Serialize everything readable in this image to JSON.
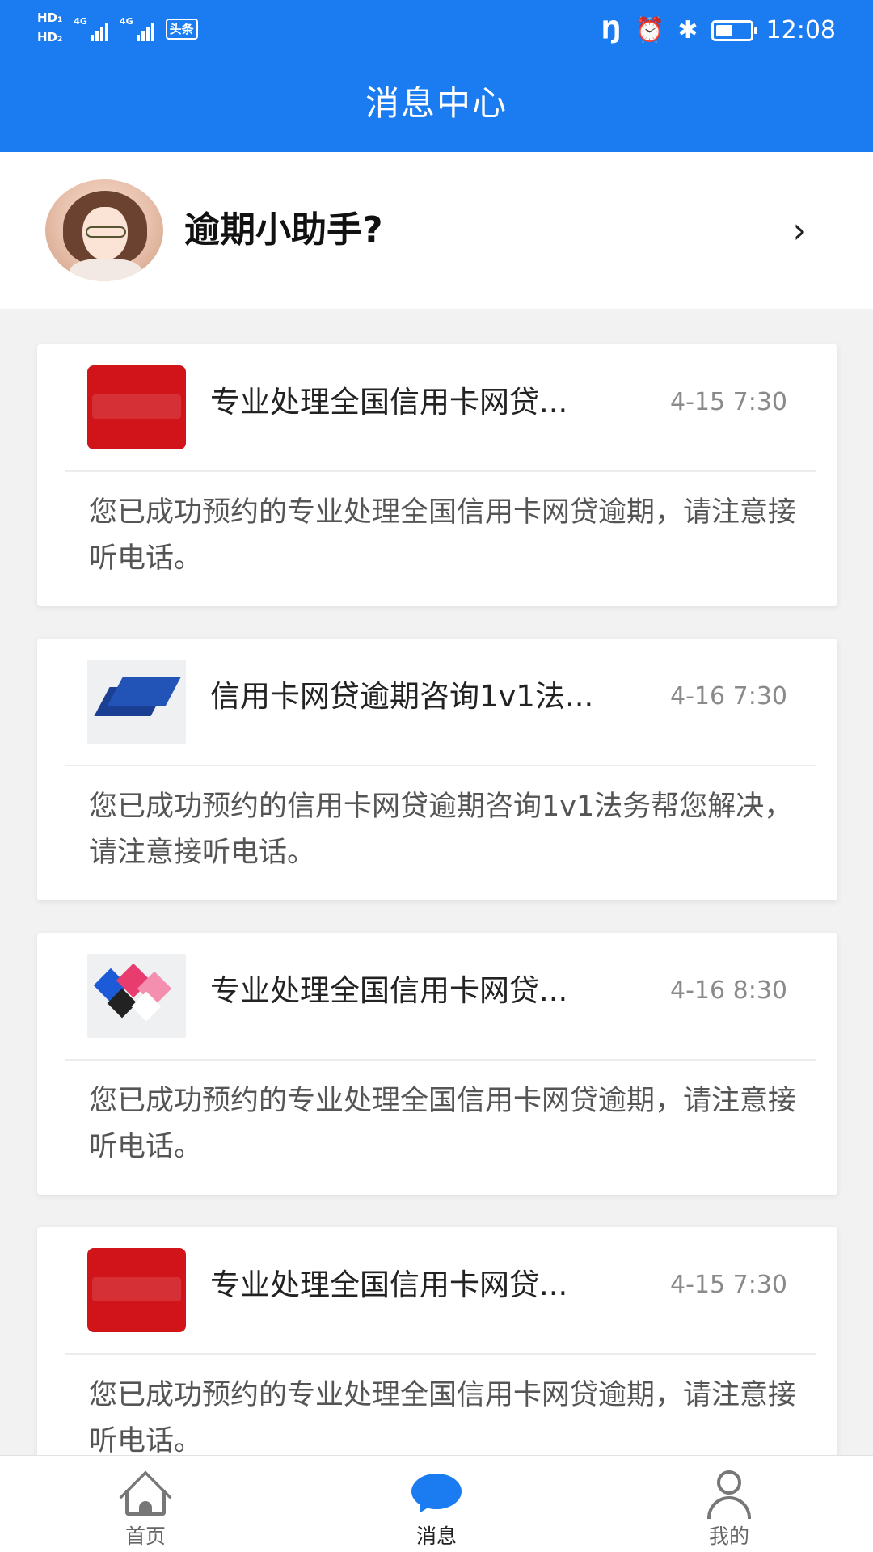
{
  "status_bar": {
    "hd1": "HD",
    "hd1_sub": "1",
    "hd2": "HD",
    "hd2_sub": "2",
    "net1": "4G",
    "net2": "4G",
    "app_badge": "头条",
    "time": "12:08",
    "icons": [
      "nfc-icon",
      "alarm-icon",
      "bluetooth-icon",
      "battery-icon"
    ]
  },
  "header": {
    "title": "消息中心"
  },
  "assistant": {
    "name": "逾期小助手?"
  },
  "messages": [
    {
      "thumb": "cny-red",
      "title": "专业处理全国信用卡网贷...",
      "time": "4-15 7:30",
      "body": "您已成功预约的专业处理全国信用卡网贷逾期，请注意接听电话。"
    },
    {
      "thumb": "blue-book",
      "title": "信用卡网贷逾期咨询1v1法...",
      "time": "4-16 7:30",
      "body": "您已成功预约的信用卡网贷逾期咨询1v1法务帮您解决，请注意接听电话。"
    },
    {
      "thumb": "color-tiles",
      "title": "专业处理全国信用卡网贷...",
      "time": "4-16 8:30",
      "body": "您已成功预约的专业处理全国信用卡网贷逾期，请注意接听电话。"
    },
    {
      "thumb": "cny-red",
      "title": "专业处理全国信用卡网贷...",
      "time": "4-15 7:30",
      "body": "您已成功预约的专业处理全国信用卡网贷逾期，请注意接听电话。"
    }
  ],
  "bottom_nav": {
    "items": [
      {
        "label": "首页",
        "icon": "home-icon",
        "active": false
      },
      {
        "label": "消息",
        "icon": "chat-icon",
        "active": true
      },
      {
        "label": "我的",
        "icon": "user-icon",
        "active": false
      }
    ]
  },
  "colors": {
    "brand": "#1a7cf0",
    "background": "#f2f2f2",
    "time_gray": "#8a8a8a"
  }
}
